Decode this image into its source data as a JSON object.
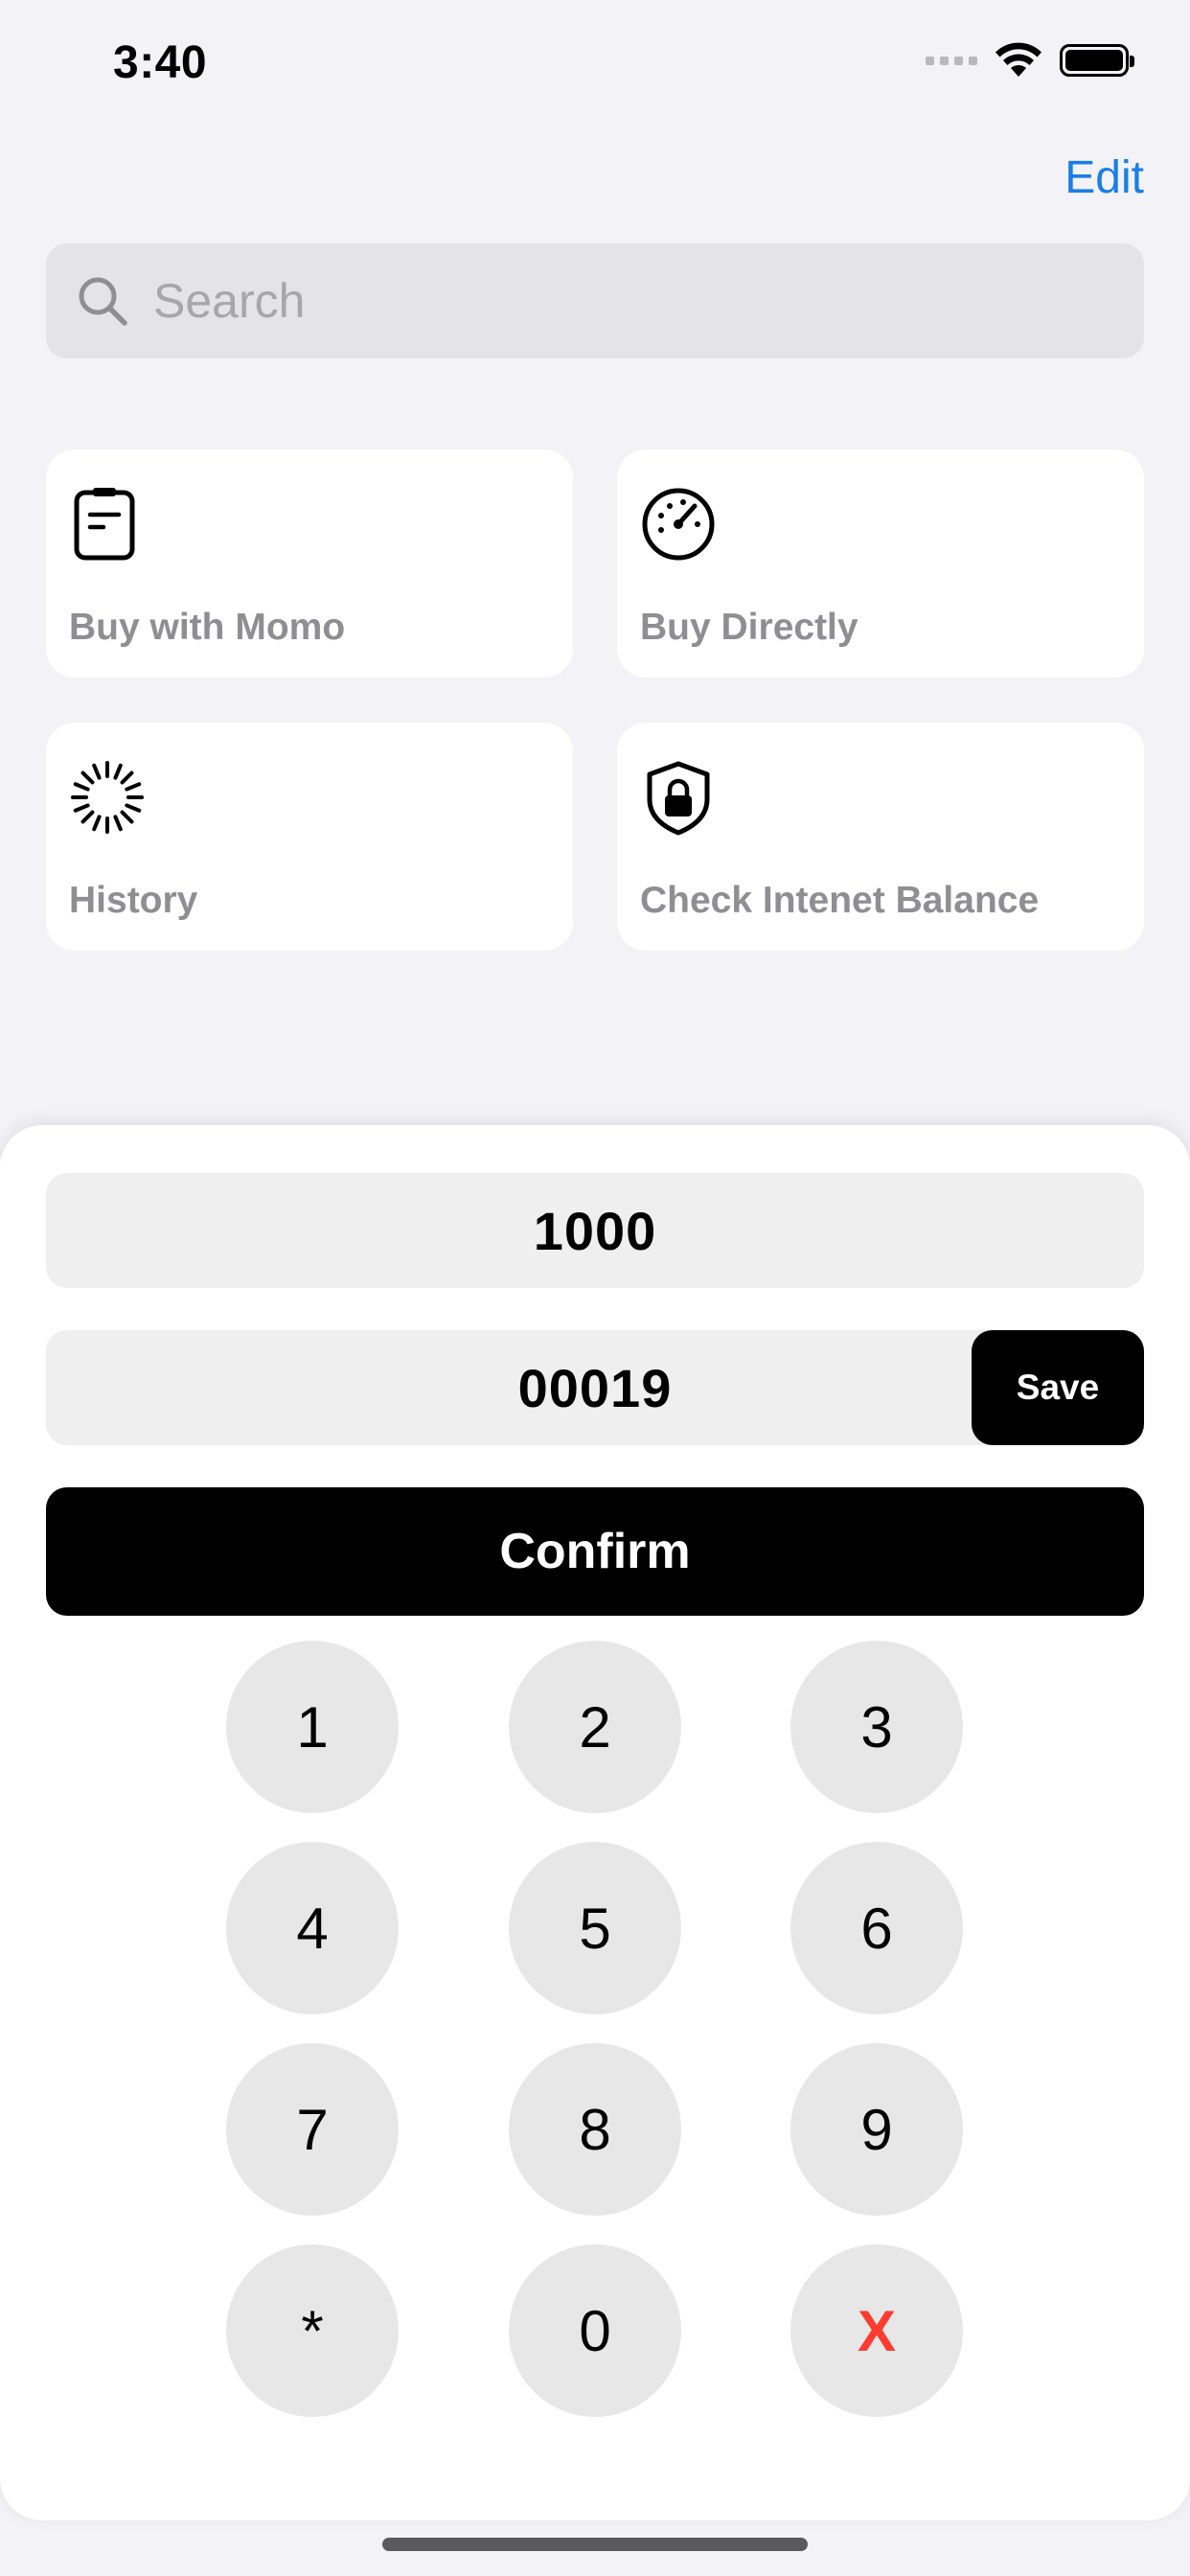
{
  "status_bar": {
    "time": "3:40",
    "icons": [
      "signal-icon",
      "wifi-icon",
      "battery-icon"
    ]
  },
  "nav": {
    "edit_label": "Edit"
  },
  "search": {
    "placeholder": "Search",
    "value": ""
  },
  "tiles": [
    {
      "label": "Buy with Momo",
      "icon": "clipboard-icon"
    },
    {
      "label": "Buy Directly",
      "icon": "speedometer-icon"
    },
    {
      "label": "History",
      "icon": "loading-spinner-icon"
    },
    {
      "label": "Check Intenet Balance",
      "icon": "lock-shield-icon"
    }
  ],
  "sheet": {
    "amount_value": "1000",
    "code_value": "00019",
    "save_label": "Save",
    "confirm_label": "Confirm",
    "keypad": [
      "1",
      "2",
      "3",
      "4",
      "5",
      "6",
      "7",
      "8",
      "9",
      "*",
      "0",
      "X"
    ]
  },
  "colors": {
    "accent": "#1a7ee6",
    "background": "#f2f2f7",
    "delete": "#ff3b30",
    "button": "#000000"
  }
}
